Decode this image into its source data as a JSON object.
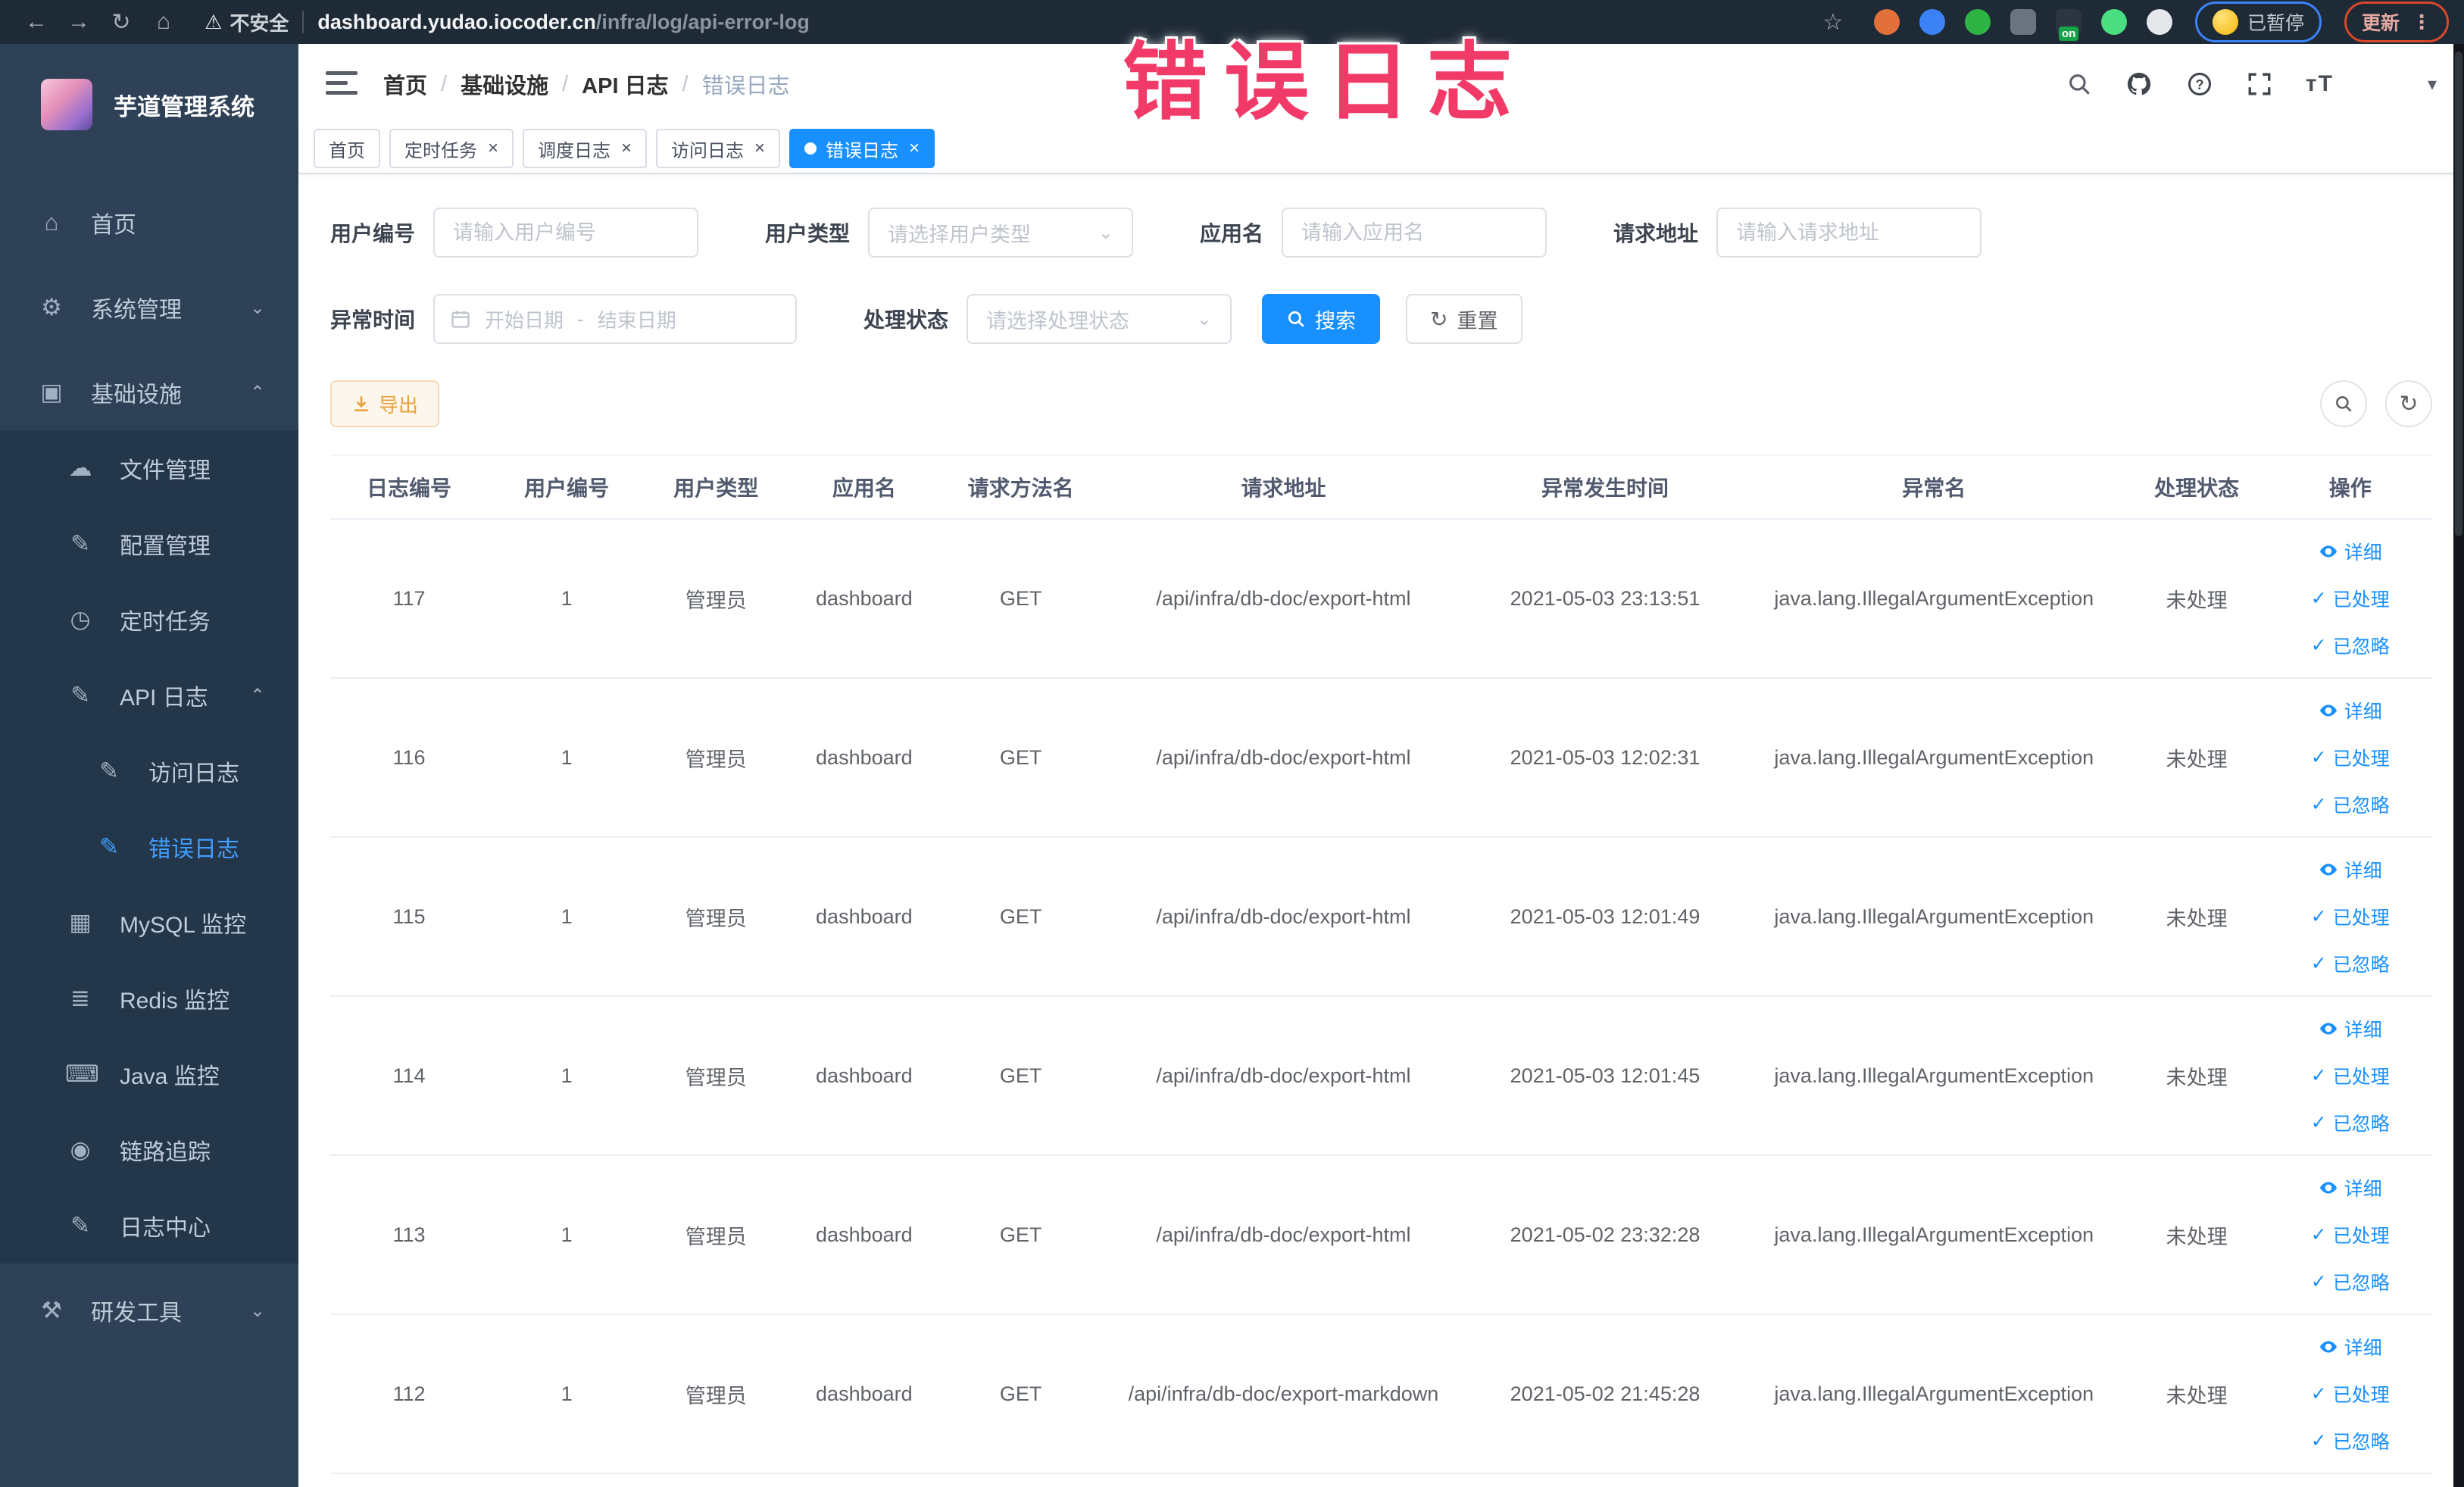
{
  "overlay": {
    "text": "错误日志",
    "color": "#f23a68"
  },
  "browser": {
    "nav_icons": [
      "back",
      "forward",
      "reload",
      "home"
    ],
    "security_label": "不安全",
    "url_host": "dashboard.yudao.iocoder.cn",
    "url_path": "/infra/log/api-error-log",
    "paused_label": "已暂停",
    "update_label": "更新",
    "extension_badge": "on",
    "extensions": [
      {
        "name": "extension-orange-icon",
        "color": "#e2703a",
        "shape": "circle"
      },
      {
        "name": "extension-blue-drop-icon",
        "color": "#3b82f6",
        "shape": "circle"
      },
      {
        "name": "extension-green-check-icon",
        "color": "#2fb344",
        "shape": "circle"
      },
      {
        "name": "extension-grid-icon",
        "color": "#6b7280",
        "shape": "square",
        "badge": ""
      },
      {
        "name": "extension-onoff-icon",
        "color": "#2d3640",
        "shape": "square",
        "badge": "on"
      },
      {
        "name": "extension-leaf-icon",
        "color": "#4ade80",
        "shape": "circle"
      },
      {
        "name": "extension-pin-icon",
        "color": "#e5e7eb",
        "shape": "circle"
      }
    ]
  },
  "sidebar": {
    "title": "芋道管理系统",
    "colors": {
      "bg": "#2e4156",
      "submenu_bg": "#24364a",
      "active": "#409eff"
    },
    "items": [
      {
        "id": "home",
        "label": "首页",
        "glyph": "⌂",
        "level": 0,
        "gap": true
      },
      {
        "id": "system-admin",
        "label": "系统管理",
        "glyph": "⚙",
        "level": 0,
        "arrow": "down",
        "gap": true
      },
      {
        "id": "infrastructure",
        "label": "基础设施",
        "glyph": "▣",
        "level": 0,
        "arrow": "up",
        "gap": true
      },
      {
        "id": "file-manage",
        "label": "文件管理",
        "glyph": "☁",
        "level": 1,
        "dark": true
      },
      {
        "id": "config-manage",
        "label": "配置管理",
        "glyph": "✎",
        "level": 1,
        "dark": true
      },
      {
        "id": "scheduled-job",
        "label": "定时任务",
        "glyph": "◷",
        "level": 1,
        "dark": true
      },
      {
        "id": "api-log",
        "label": "API 日志",
        "glyph": "✎",
        "level": 1,
        "dark": true,
        "arrow": "up"
      },
      {
        "id": "access-log",
        "label": "访问日志",
        "glyph": "✎",
        "level": 2,
        "dark": true
      },
      {
        "id": "error-log",
        "label": "错误日志",
        "glyph": "✎",
        "level": 2,
        "dark": true,
        "active": true
      },
      {
        "id": "mysql-monitor",
        "label": "MySQL 监控",
        "glyph": "▦",
        "level": 1,
        "dark": true
      },
      {
        "id": "redis-monitor",
        "label": "Redis 监控",
        "glyph": "≣",
        "level": 1,
        "dark": true
      },
      {
        "id": "java-monitor",
        "label": "Java 监控",
        "glyph": "⌨",
        "level": 1,
        "dark": true
      },
      {
        "id": "trace",
        "label": "链路追踪",
        "glyph": "◉",
        "level": 1,
        "dark": true
      },
      {
        "id": "log-center",
        "label": "日志中心",
        "glyph": "✎",
        "level": 1,
        "dark": true
      },
      {
        "id": "dev-tools",
        "label": "研发工具",
        "glyph": "⚒",
        "level": 0,
        "arrow": "down",
        "gap": true
      }
    ]
  },
  "breadcrumb": [
    "首页",
    "基础设施",
    "API 日志",
    "错误日志"
  ],
  "header_icons": [
    "search",
    "github",
    "help",
    "fullscreen",
    "font-size",
    "avatar",
    "caret"
  ],
  "tabs": [
    {
      "id": "tab-home",
      "label": "首页",
      "closable": false,
      "active": false
    },
    {
      "id": "tab-job",
      "label": "定时任务",
      "closable": true,
      "active": false
    },
    {
      "id": "tab-job-log",
      "label": "调度日志",
      "closable": true,
      "active": false
    },
    {
      "id": "tab-access-log",
      "label": "访问日志",
      "closable": true,
      "active": false
    },
    {
      "id": "tab-error-log",
      "label": "错误日志",
      "closable": true,
      "active": true
    }
  ],
  "filters": {
    "user_id": {
      "label": "用户编号",
      "placeholder": "请输入用户编号"
    },
    "user_type": {
      "label": "用户类型",
      "placeholder": "请选择用户类型"
    },
    "app_name": {
      "label": "应用名",
      "placeholder": "请输入应用名"
    },
    "request_url": {
      "label": "请求地址",
      "placeholder": "请输入请求地址"
    },
    "error_time": {
      "label": "异常时间",
      "start_placeholder": "开始日期",
      "separator": "-",
      "end_placeholder": "结束日期"
    },
    "status": {
      "label": "处理状态",
      "placeholder": "请选择处理状态"
    },
    "search_label": "搜索",
    "reset_label": "重置"
  },
  "toolbar": {
    "export_label": "导出"
  },
  "table": {
    "columns": [
      "日志编号",
      "用户编号",
      "用户类型",
      "应用名",
      "请求方法名",
      "请求地址",
      "异常发生时间",
      "异常名",
      "处理状态",
      "操作"
    ],
    "col_widths": [
      "7.5%",
      "7.5%",
      "6.7%",
      "7.4%",
      "7.5%",
      "17.5%",
      "13.1%",
      "18.2%",
      "6.8%",
      "7.8%"
    ],
    "row_actions": [
      {
        "label": "详细",
        "icon": "eye"
      },
      {
        "label": "已处理",
        "icon": "check"
      },
      {
        "label": "已忽略",
        "icon": "check"
      }
    ],
    "rows": [
      [
        "117",
        "1",
        "管理员",
        "dashboard",
        "GET",
        "/api/infra/db-doc/export-html",
        "2021-05-03 23:13:51",
        "java.lang.IllegalArgumentException",
        "未处理"
      ],
      [
        "116",
        "1",
        "管理员",
        "dashboard",
        "GET",
        "/api/infra/db-doc/export-html",
        "2021-05-03 12:02:31",
        "java.lang.IllegalArgumentException",
        "未处理"
      ],
      [
        "115",
        "1",
        "管理员",
        "dashboard",
        "GET",
        "/api/infra/db-doc/export-html",
        "2021-05-03 12:01:49",
        "java.lang.IllegalArgumentException",
        "未处理"
      ],
      [
        "114",
        "1",
        "管理员",
        "dashboard",
        "GET",
        "/api/infra/db-doc/export-html",
        "2021-05-03 12:01:45",
        "java.lang.IllegalArgumentException",
        "未处理"
      ],
      [
        "113",
        "1",
        "管理员",
        "dashboard",
        "GET",
        "/api/infra/db-doc/export-html",
        "2021-05-02 23:32:28",
        "java.lang.IllegalArgumentException",
        "未处理"
      ],
      [
        "112",
        "1",
        "管理员",
        "dashboard",
        "GET",
        "/api/infra/db-doc/export-markdown",
        "2021-05-02 21:45:28",
        "java.lang.IllegalArgumentException",
        "未处理"
      ]
    ]
  }
}
